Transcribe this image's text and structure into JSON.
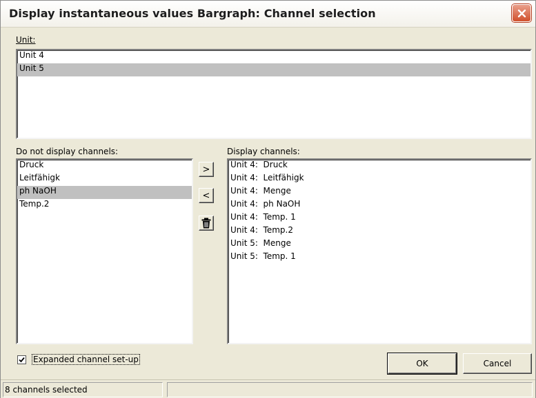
{
  "window": {
    "title": "Display instantaneous values Bargraph: Channel selection"
  },
  "unit_section": {
    "label": "Unit:",
    "items": [
      {
        "label": "Unit 4",
        "selected": false
      },
      {
        "label": "Unit 5",
        "selected": true
      }
    ]
  },
  "available_channels": {
    "label": "Do not display channels:",
    "items": [
      {
        "label": "Druck",
        "selected": false
      },
      {
        "label": "Leitfähigk",
        "selected": false
      },
      {
        "label": "ph NaOH",
        "selected": true
      },
      {
        "label": "Temp.2",
        "selected": false
      }
    ]
  },
  "display_channels": {
    "label": "Display channels:",
    "items": [
      "Unit 4:  Druck",
      "Unit 4:  Leitfähigk",
      "Unit 4:  Menge",
      "Unit 4:  ph NaOH",
      "Unit 4:  Temp. 1",
      "Unit 4:  Temp.2",
      "Unit 5:  Menge",
      "Unit 5:  Temp. 1"
    ]
  },
  "transfer_buttons": {
    "add_label": ">",
    "remove_label": "<",
    "delete_icon": "trash-icon"
  },
  "options": {
    "expanded_setup_label": "Expanded channel set-up",
    "expanded_setup_checked": true
  },
  "buttons": {
    "ok_label": "OK",
    "cancel_label": "Cancel"
  },
  "status": {
    "text": "8 channels selected",
    "secondary": ""
  },
  "colors": {
    "dialog_bg": "#ece9d8",
    "selection": "#c0c0c0",
    "close_button": "#d0502c"
  }
}
